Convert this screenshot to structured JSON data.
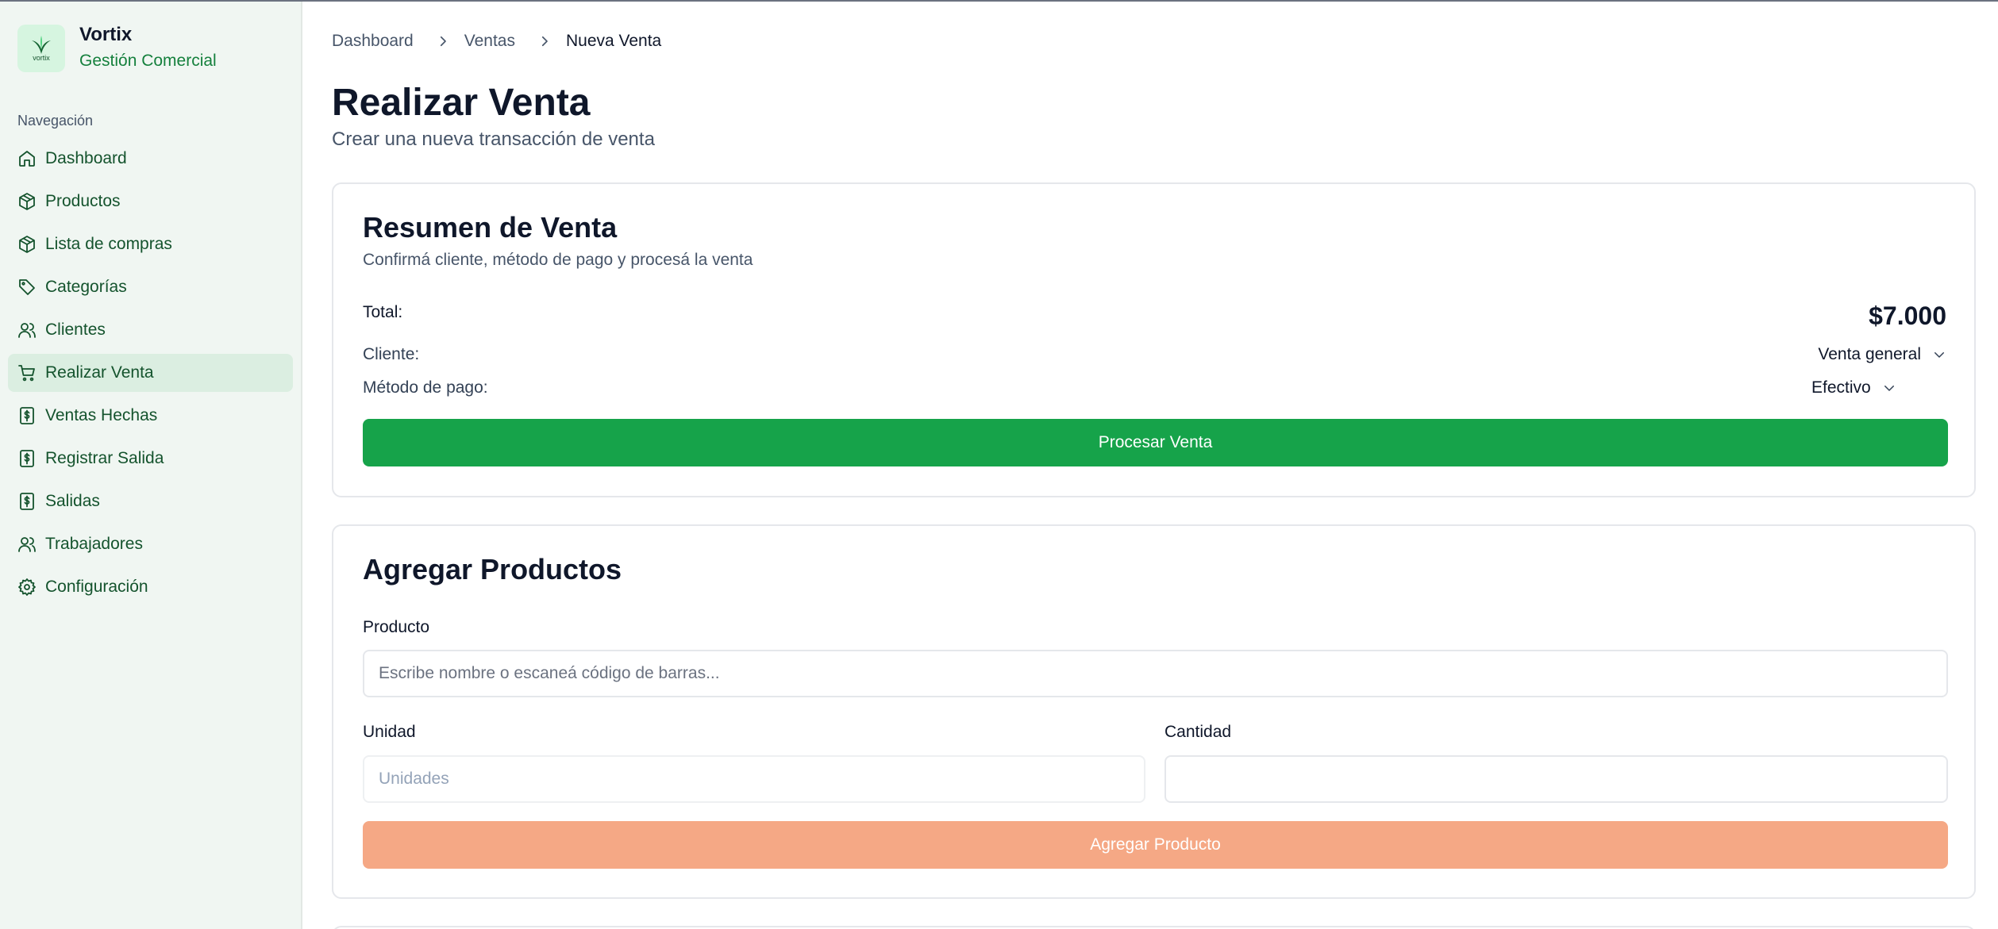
{
  "brand": {
    "name": "Vortix",
    "subtitle": "Gestión Comercial",
    "logo_text": "vortix"
  },
  "sidebar": {
    "heading": "Navegación",
    "items": [
      {
        "label": "Dashboard",
        "icon": "home-icon"
      },
      {
        "label": "Productos",
        "icon": "box-icon"
      },
      {
        "label": "Lista de compras",
        "icon": "box-icon"
      },
      {
        "label": "Categorías",
        "icon": "tag-icon"
      },
      {
        "label": "Clientes",
        "icon": "users-icon"
      },
      {
        "label": "Realizar Venta",
        "icon": "cart-icon",
        "active": true
      },
      {
        "label": "Ventas Hechas",
        "icon": "dollar-doc-icon"
      },
      {
        "label": "Registrar Salida",
        "icon": "dollar-doc-icon"
      },
      {
        "label": "Salidas",
        "icon": "dollar-doc-icon"
      },
      {
        "label": "Trabajadores",
        "icon": "users-icon"
      },
      {
        "label": "Configuración",
        "icon": "gear-icon"
      }
    ]
  },
  "breadcrumb": {
    "items": [
      "Dashboard",
      "Ventas",
      "Nueva Venta"
    ]
  },
  "page": {
    "title": "Realizar Venta",
    "subtitle": "Crear una nueva transacción de venta"
  },
  "summary": {
    "title": "Resumen de Venta",
    "subtitle": "Confirmá cliente, método de pago y procesá la venta",
    "total_label": "Total:",
    "total_value": "$7.000",
    "client_label": "Cliente:",
    "client_value": "Venta general",
    "payment_label": "Método de pago:",
    "payment_value": "Efectivo",
    "process_button": "Procesar Venta"
  },
  "add_products": {
    "title": "Agregar Productos",
    "product_label": "Producto",
    "product_placeholder": "Escribe nombre o escaneá código de barras...",
    "unit_label": "Unidad",
    "unit_value": "Unidades",
    "quantity_label": "Cantidad",
    "quantity_value": "",
    "add_button": "Agregar Producto"
  },
  "colors": {
    "primary": "#16a34a",
    "secondary_button": "#f5a885",
    "sidebar_bg": "#f0f6f2",
    "active_bg": "#dbeee1",
    "brand_green": "#15803d"
  }
}
